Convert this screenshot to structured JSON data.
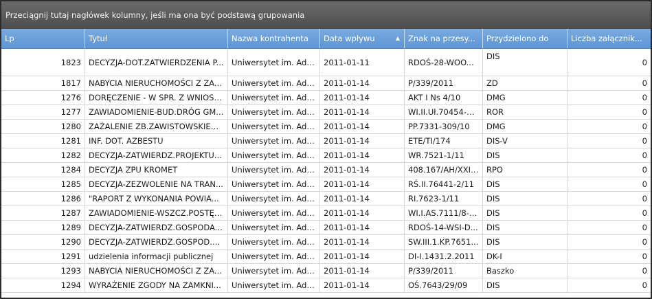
{
  "group_panel": {
    "text": "Przeciągnij tutaj nagłówek kolumny, jeśli ma ona być podstawą grupowania"
  },
  "columns": [
    {
      "label": "Lp"
    },
    {
      "label": "Tytuł"
    },
    {
      "label": "Nazwa kontrahenta"
    },
    {
      "label": "Data wpływu",
      "sorted": "asc"
    },
    {
      "label": "Znak na przesy..."
    },
    {
      "label": "Przydzielono do"
    },
    {
      "label": "Liczba załącznik..."
    }
  ],
  "rows": [
    {
      "lp": "1823",
      "tytul": "DECYZJA-DOT.ZATWIERDZENIA P...",
      "kontrahent": "Uniwersytet im. Ada...",
      "data": "2011-01-11",
      "znak": "RDOŚ-28-WOO...",
      "przydzielono": "DIS",
      "zalaczniki": "0"
    },
    {
      "lp": "1817",
      "tytul": "NABYCIA NIERUCHOMOŚCI Z ZA...",
      "kontrahent": "Uniwersytet im. Ada...",
      "data": "2011-01-14",
      "znak": "P/339/2011",
      "przydzielono": "ZD",
      "zalaczniki": "0"
    },
    {
      "lp": "1276",
      "tytul": "DORĘCZENIE - W SPR. Z WNIOSK...",
      "kontrahent": "Uniwersytet im. Ada...",
      "data": "2011-01-14",
      "znak": "AKT I Ns 4/10",
      "przydzielono": "DMG",
      "zalaczniki": "0"
    },
    {
      "lp": "1277",
      "tytul": "ZAWIADOMIENIE-BUD.DRÓG GM...",
      "kontrahent": "Uniwersytet im. Ada...",
      "data": "2011-01-14",
      "znak": "WI.II.Uł.70454-1...",
      "przydzielono": "ROR",
      "zalaczniki": "0"
    },
    {
      "lp": "1280",
      "tytul": "ZAŻALENIE ZB.ZAWISTOWSKIEG...",
      "kontrahent": "Uniwersytet im. Ada...",
      "data": "2011-01-14",
      "znak": "PP.7331-309/10",
      "przydzielono": "DMG",
      "zalaczniki": "0"
    },
    {
      "lp": "1281",
      "tytul": "INF. DOT. AZBESTU",
      "kontrahent": "Uniwersytet im. Ada...",
      "data": "2011-01-14",
      "znak": "ETE/TI/174",
      "przydzielono": "DIS-V",
      "zalaczniki": "0"
    },
    {
      "lp": "1282",
      "tytul": "DECYZJA-ZATWIERDZ.PROJEKTU...",
      "kontrahent": "Uniwersytet im. Ada...",
      "data": "2011-01-14",
      "znak": "WR.7521-1/11",
      "przydzielono": "DIS",
      "zalaczniki": "0"
    },
    {
      "lp": "1284",
      "tytul": "DECYZJA ZPU KROMET",
      "kontrahent": "Uniwersytet im. Ada...",
      "data": "2011-01-14",
      "znak": "408.167/AH/XXII...",
      "przydzielono": "RPO",
      "zalaczniki": "0"
    },
    {
      "lp": "1285",
      "tytul": "DECYZJA-ZEZWOLENIE NA TRAN...",
      "kontrahent": "Uniwersytet im. Ada...",
      "data": "2011-01-14",
      "znak": "RŚ.II.76441-2/11",
      "przydzielono": "DIS",
      "zalaczniki": "0"
    },
    {
      "lp": "1286",
      "tytul": "\"RAPORT Z WYKONANIA POWIA...",
      "kontrahent": "Uniwersytet im. Ada...",
      "data": "2011-01-14",
      "znak": "RI.7623-1/11",
      "przydzielono": "DIS",
      "zalaczniki": "0"
    },
    {
      "lp": "1287",
      "tytul": "ZAWIADOMIENIE-WSZCZ.POSTĘP...",
      "kontrahent": "Uniwersytet im. Ada...",
      "data": "2011-01-14",
      "znak": "WI.I.AS.7111/8-4...",
      "przydzielono": "DIS",
      "zalaczniki": "0"
    },
    {
      "lp": "1289",
      "tytul": "DECYZJA-ZATWIERDZ.GOSPODA...",
      "kontrahent": "Uniwersytet im. Ada...",
      "data": "2011-01-14",
      "znak": "RDOŚ-14-WSI-D...",
      "przydzielono": "DIS",
      "zalaczniki": "0"
    },
    {
      "lp": "1290",
      "tytul": "DECYZJA-ZATWIERDZ.GOSPOD.O...",
      "kontrahent": "Uniwersytet im. Ada...",
      "data": "2011-01-14",
      "znak": "SW.III.1.KP.7651...",
      "przydzielono": "DIS",
      "zalaczniki": "0"
    },
    {
      "lp": "1291",
      "tytul": "udzielenia informacji publicznej",
      "kontrahent": "Uniwersytet im. Ada...",
      "data": "2011-01-14",
      "znak": "DI-I.1431.2.2011",
      "przydzielono": "DK-I",
      "zalaczniki": "0"
    },
    {
      "lp": "1293",
      "tytul": "NABYCIA NIERUCHOMOŚCI Z ZA...",
      "kontrahent": "Uniwersytet im. Ada...",
      "data": "2011-01-14",
      "znak": "P/339/2011",
      "przydzielono": "Baszko",
      "zalaczniki": "0"
    },
    {
      "lp": "1294",
      "tytul": "WYRAŻENIE ZGODY NA ZAMKNI...",
      "kontrahent": "Uniwersytet im. Ada...",
      "data": "2011-01-14",
      "znak": "OŚ.7643/29/09",
      "przydzielono": "DIS",
      "zalaczniki": "0"
    }
  ]
}
